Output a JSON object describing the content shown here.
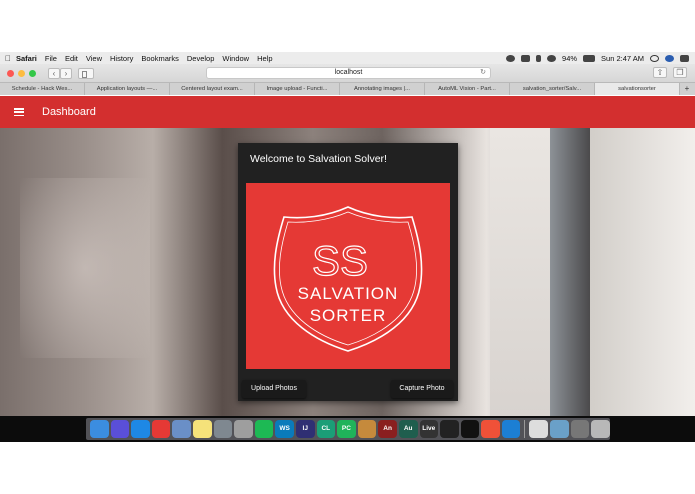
{
  "menubar": {
    "apple_icon": "apple-icon",
    "app_name": "Safari",
    "items": [
      "File",
      "Edit",
      "View",
      "History",
      "Bookmarks",
      "Develop",
      "Window",
      "Help"
    ],
    "battery": "94%",
    "clock": "Sun 2:47 AM"
  },
  "browser": {
    "url": "localhost",
    "tabs": [
      {
        "label": "Schedule - Hack Wes..."
      },
      {
        "label": "Application layouts —..."
      },
      {
        "label": "Centered layout exam..."
      },
      {
        "label": "Image upload - Functi..."
      },
      {
        "label": "Annotating images  |..."
      },
      {
        "label": "AutoML Vision - Part..."
      },
      {
        "label": "salvation_sorter/Salv..."
      },
      {
        "label": "salvationsorter"
      }
    ],
    "new_tab_label": "+"
  },
  "app": {
    "title": "Dashboard",
    "card": {
      "title": "Welcome to Salvation Solver!",
      "logo_monogram": "SS",
      "logo_line1": "SALVATION",
      "logo_line2": "SORTER",
      "upload_label": "Upload Photos",
      "capture_label": "Capture Photo"
    }
  },
  "dock": {
    "apps": [
      {
        "name": "finder-icon",
        "label": "",
        "color": "#3b8de0"
      },
      {
        "name": "siri-icon",
        "label": "",
        "color": "#5a4fd8"
      },
      {
        "name": "safari-icon",
        "label": "",
        "color": "#1e88e5"
      },
      {
        "name": "chrome-icon",
        "label": "",
        "color": "#e53935"
      },
      {
        "name": "preview-icon",
        "label": "",
        "color": "#6a8fc7"
      },
      {
        "name": "notes-icon",
        "label": "",
        "color": "#f5e27a"
      },
      {
        "name": "system-preferences-icon",
        "label": "",
        "color": "#7f8890"
      },
      {
        "name": "disk-utility-icon",
        "label": "",
        "color": "#9e9e9e"
      },
      {
        "name": "spotify-icon",
        "label": "",
        "color": "#1db954"
      },
      {
        "name": "webstorm-icon",
        "label": "WS",
        "color": "#0a7bbb"
      },
      {
        "name": "intellij-icon",
        "label": "IJ",
        "color": "#2f2f73"
      },
      {
        "name": "clion-icon",
        "label": "CL",
        "color": "#1b9e77"
      },
      {
        "name": "pycharm-icon",
        "label": "PC",
        "color": "#20b35a"
      },
      {
        "name": "books-icon",
        "label": "",
        "color": "#c58a3c"
      },
      {
        "name": "animate-icon",
        "label": "An",
        "color": "#8a1f1f"
      },
      {
        "name": "audition-icon",
        "label": "Au",
        "color": "#1f5e4e"
      },
      {
        "name": "live-icon",
        "label": "Live",
        "color": "#333333"
      },
      {
        "name": "unity-icon",
        "label": "",
        "color": "#222222"
      },
      {
        "name": "terminal-icon",
        "label": "",
        "color": "#111111"
      },
      {
        "name": "swift-icon",
        "label": "",
        "color": "#f05138"
      },
      {
        "name": "xcode-icon",
        "label": "",
        "color": "#1c7fd4"
      },
      {
        "name": "hand-tool-icon",
        "label": "",
        "color": "#dddddd"
      },
      {
        "name": "photos-icon",
        "label": "",
        "color": "#6aa0c8"
      },
      {
        "name": "word-icon",
        "label": "",
        "color": "#777777"
      },
      {
        "name": "trash-icon",
        "label": "",
        "color": "#b8b8b8"
      }
    ]
  }
}
